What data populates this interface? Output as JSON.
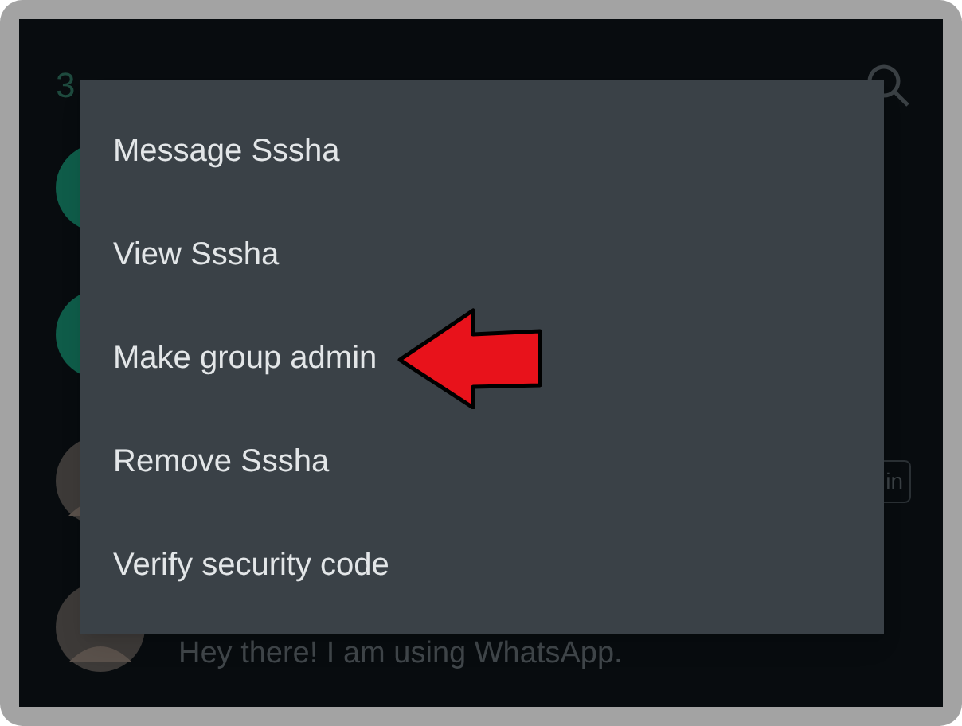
{
  "header": {
    "title": "3"
  },
  "participants": [
    {
      "kind": "action"
    },
    {
      "kind": "action"
    },
    {
      "kind": "contact",
      "badge": "in"
    },
    {
      "kind": "contact",
      "status": "Hey there! I am using WhatsApp."
    }
  ],
  "context_menu": {
    "items": [
      {
        "label": "Message Sssha",
        "annotated": false
      },
      {
        "label": "View Sssha",
        "annotated": false
      },
      {
        "label": "Make group admin",
        "annotated": true
      },
      {
        "label": "Remove Sssha",
        "annotated": false
      },
      {
        "label": "Verify security code",
        "annotated": false
      }
    ]
  }
}
